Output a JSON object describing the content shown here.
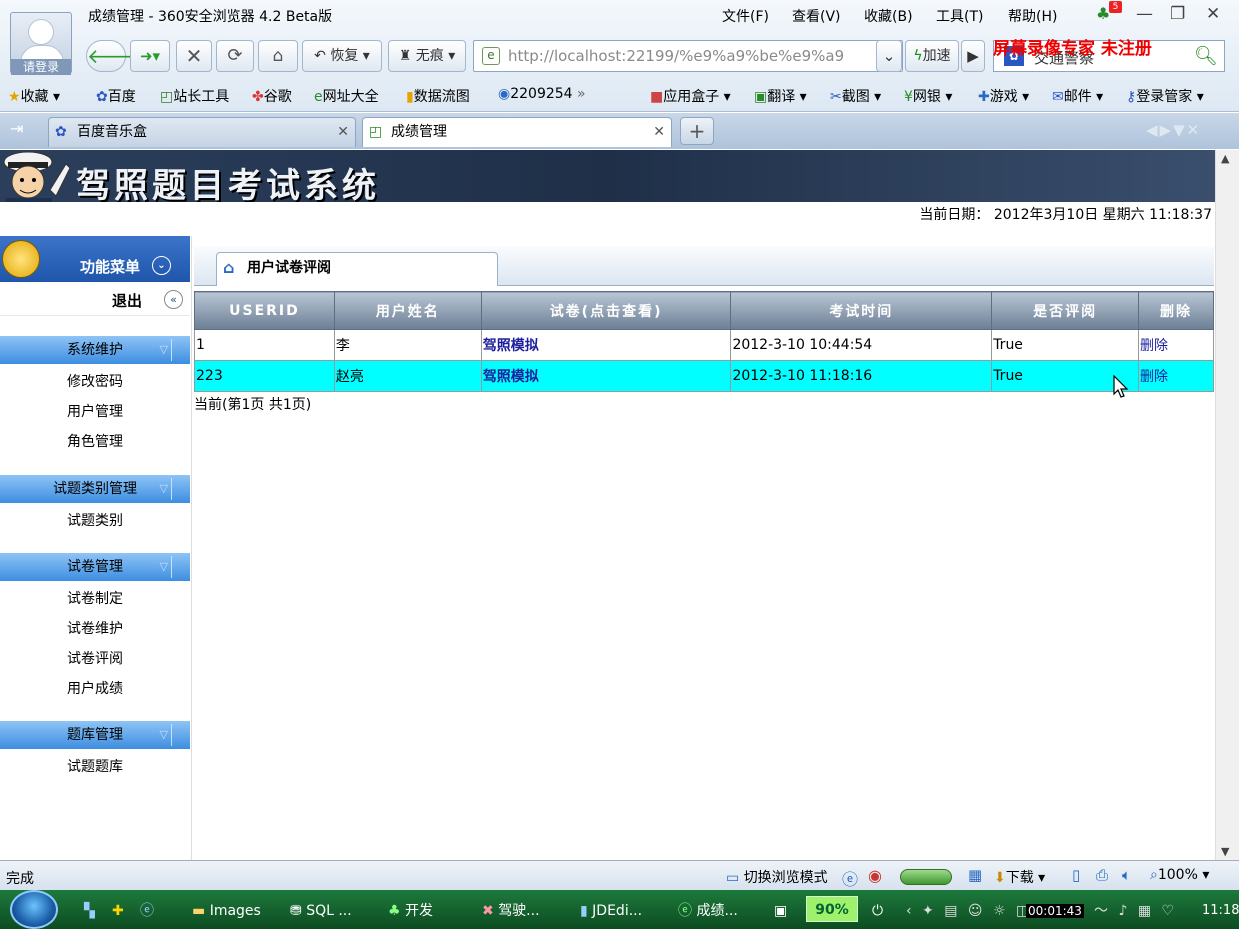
{
  "browser": {
    "avatar_label": "请登录",
    "title": "成绩管理 - 360安全浏览器 4.2 Beta版",
    "menus": [
      "文件(F)",
      "查看(V)",
      "收藏(B)",
      "工具(T)",
      "帮助(H)"
    ],
    "notif_count": "5",
    "nav": {
      "restore": "恢复",
      "incognito": "无痕"
    },
    "url": "http://localhost:22199/%e9%a9%be%e9%a9",
    "accelerate": "加速",
    "search_text": "交通警察",
    "watermark": "屏幕录像专家  未注册",
    "favorites": [
      "收藏",
      "百度",
      "站长工具",
      "谷歌",
      "网址大全",
      "数据流图",
      "2209254"
    ],
    "tools": [
      "应用盒子",
      "翻译",
      "截图",
      "网银",
      "游戏",
      "邮件",
      "登录管家"
    ],
    "tabs": [
      {
        "label": "百度音乐盒"
      },
      {
        "label": "成绩管理"
      }
    ],
    "status": "完成",
    "status_right": {
      "mode": "切换浏览模式",
      "download": "下载",
      "zoom": "100%"
    }
  },
  "page": {
    "banner_title": "驾照题目考试系统",
    "date": "当前日期： 2012年3月10日  星期六   11:18:37",
    "menu_title": "功能菜单",
    "logout": "退出",
    "groups": [
      {
        "title": "系统维护",
        "items": [
          "修改密码",
          "用户管理",
          "角色管理"
        ]
      },
      {
        "title": "试题类别管理",
        "items": [
          "试题类别"
        ]
      },
      {
        "title": "试卷管理",
        "items": [
          "试卷制定",
          "试卷维护",
          "试卷评阅",
          "用户成绩"
        ]
      },
      {
        "title": "题库管理",
        "items": [
          "试题题库"
        ]
      }
    ],
    "panel_title": "用户试卷评阅",
    "table": {
      "headers": [
        "USERID",
        "用户姓名",
        "试卷(点击查看)",
        "考试时间",
        "是否评阅",
        "删除"
      ],
      "rows": [
        [
          "1",
          "李",
          "驾照模拟",
          "2012-3-10 10:44:54",
          "True",
          "删除"
        ],
        [
          "223",
          "赵亮",
          "驾照模拟",
          "2012-3-10 11:18:16",
          "True",
          "删除"
        ]
      ]
    },
    "pager": "当前(第1页 共1页)"
  },
  "taskbar": {
    "items": [
      "Images",
      "SQL ...",
      "开发",
      "驾驶...",
      "JDEdi...",
      "成绩..."
    ],
    "percent": "90%",
    "recorder": "00:01:43",
    "clock": "11:18"
  }
}
